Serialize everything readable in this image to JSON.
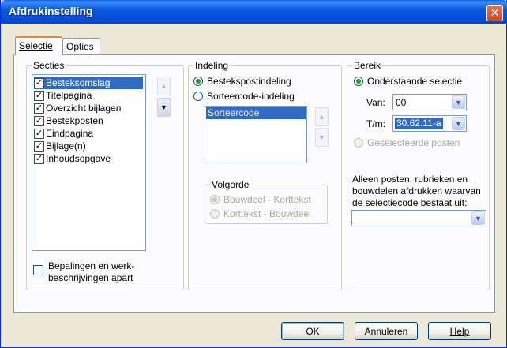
{
  "window": {
    "title": "Afdrukinstelling",
    "close_glyph": "✕"
  },
  "tabs": [
    {
      "label": "Selectie",
      "active": true
    },
    {
      "label": "Opties",
      "active": false
    }
  ],
  "secties": {
    "label": "Secties",
    "items": [
      {
        "label": "Besteksomslag",
        "checked": true,
        "selected": true
      },
      {
        "label": "Titelpagina",
        "checked": true
      },
      {
        "label": "Overzicht bijlagen",
        "checked": true
      },
      {
        "label": "Bestekposten",
        "checked": true
      },
      {
        "label": "Eindpagina",
        "checked": true
      },
      {
        "label": "Bijlage(n)",
        "checked": true
      },
      {
        "label": "Inhoudsopgave",
        "checked": true
      }
    ],
    "up_glyph": "▲",
    "down_glyph": "▼",
    "apart_checkbox_label_line1": "Bepalingen en werk-",
    "apart_checkbox_label_line2": "beschrijvingen apart"
  },
  "indeling": {
    "label": "Indeling",
    "option1": "Bestekspostindeling",
    "option2": "Sorteercode-indeling",
    "list_items": [
      "Sorteercode"
    ],
    "volgorde": {
      "label": "Volgorde",
      "option1": "Bouwdeel - Korttekst",
      "option2": "Korttekst - Bouwdeel"
    }
  },
  "bereik": {
    "label": "Bereik",
    "option1": "Onderstaande selectie",
    "van_label": "Van:",
    "van_value": "00",
    "tm_label": "T/m:",
    "tm_value": "30.62.11-a",
    "option2": "Geselecteerde posten",
    "description_line1": "Alleen posten, rubrieken en",
    "description_line2": "bouwdelen afdrukken waarvan",
    "description_line3": "de selectiecode bestaat uit:",
    "selectiecode_value": ""
  },
  "buttons": {
    "ok": "OK",
    "annuleren": "Annuleren",
    "help": "Help"
  },
  "colors": {
    "title_bar": "#0550dc",
    "selection": "#316ac5",
    "dialog_bg": "#ece9d8"
  }
}
